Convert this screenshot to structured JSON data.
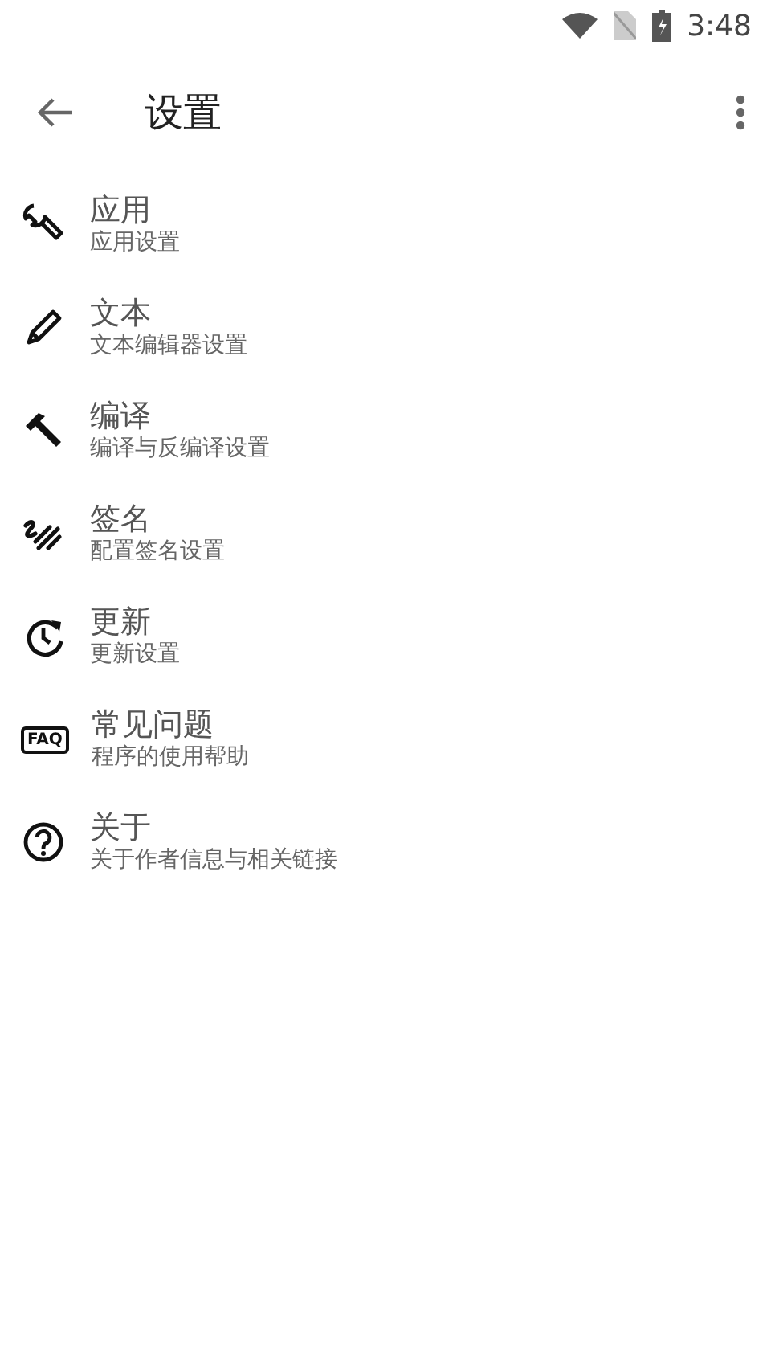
{
  "status_bar": {
    "time": "3:48"
  },
  "toolbar": {
    "title": "设置"
  },
  "items": [
    {
      "title": "应用",
      "subtitle": "应用设置"
    },
    {
      "title": "文本",
      "subtitle": "文本编辑器设置"
    },
    {
      "title": "编译",
      "subtitle": "编译与反编译设置"
    },
    {
      "title": "签名",
      "subtitle": "配置签名设置"
    },
    {
      "title": "更新",
      "subtitle": "更新设置"
    },
    {
      "icon_text": "FAQ",
      "title": "常见问题",
      "subtitle": "程序的使用帮助"
    },
    {
      "title": "关于",
      "subtitle": "关于作者信息与相关链接"
    }
  ]
}
